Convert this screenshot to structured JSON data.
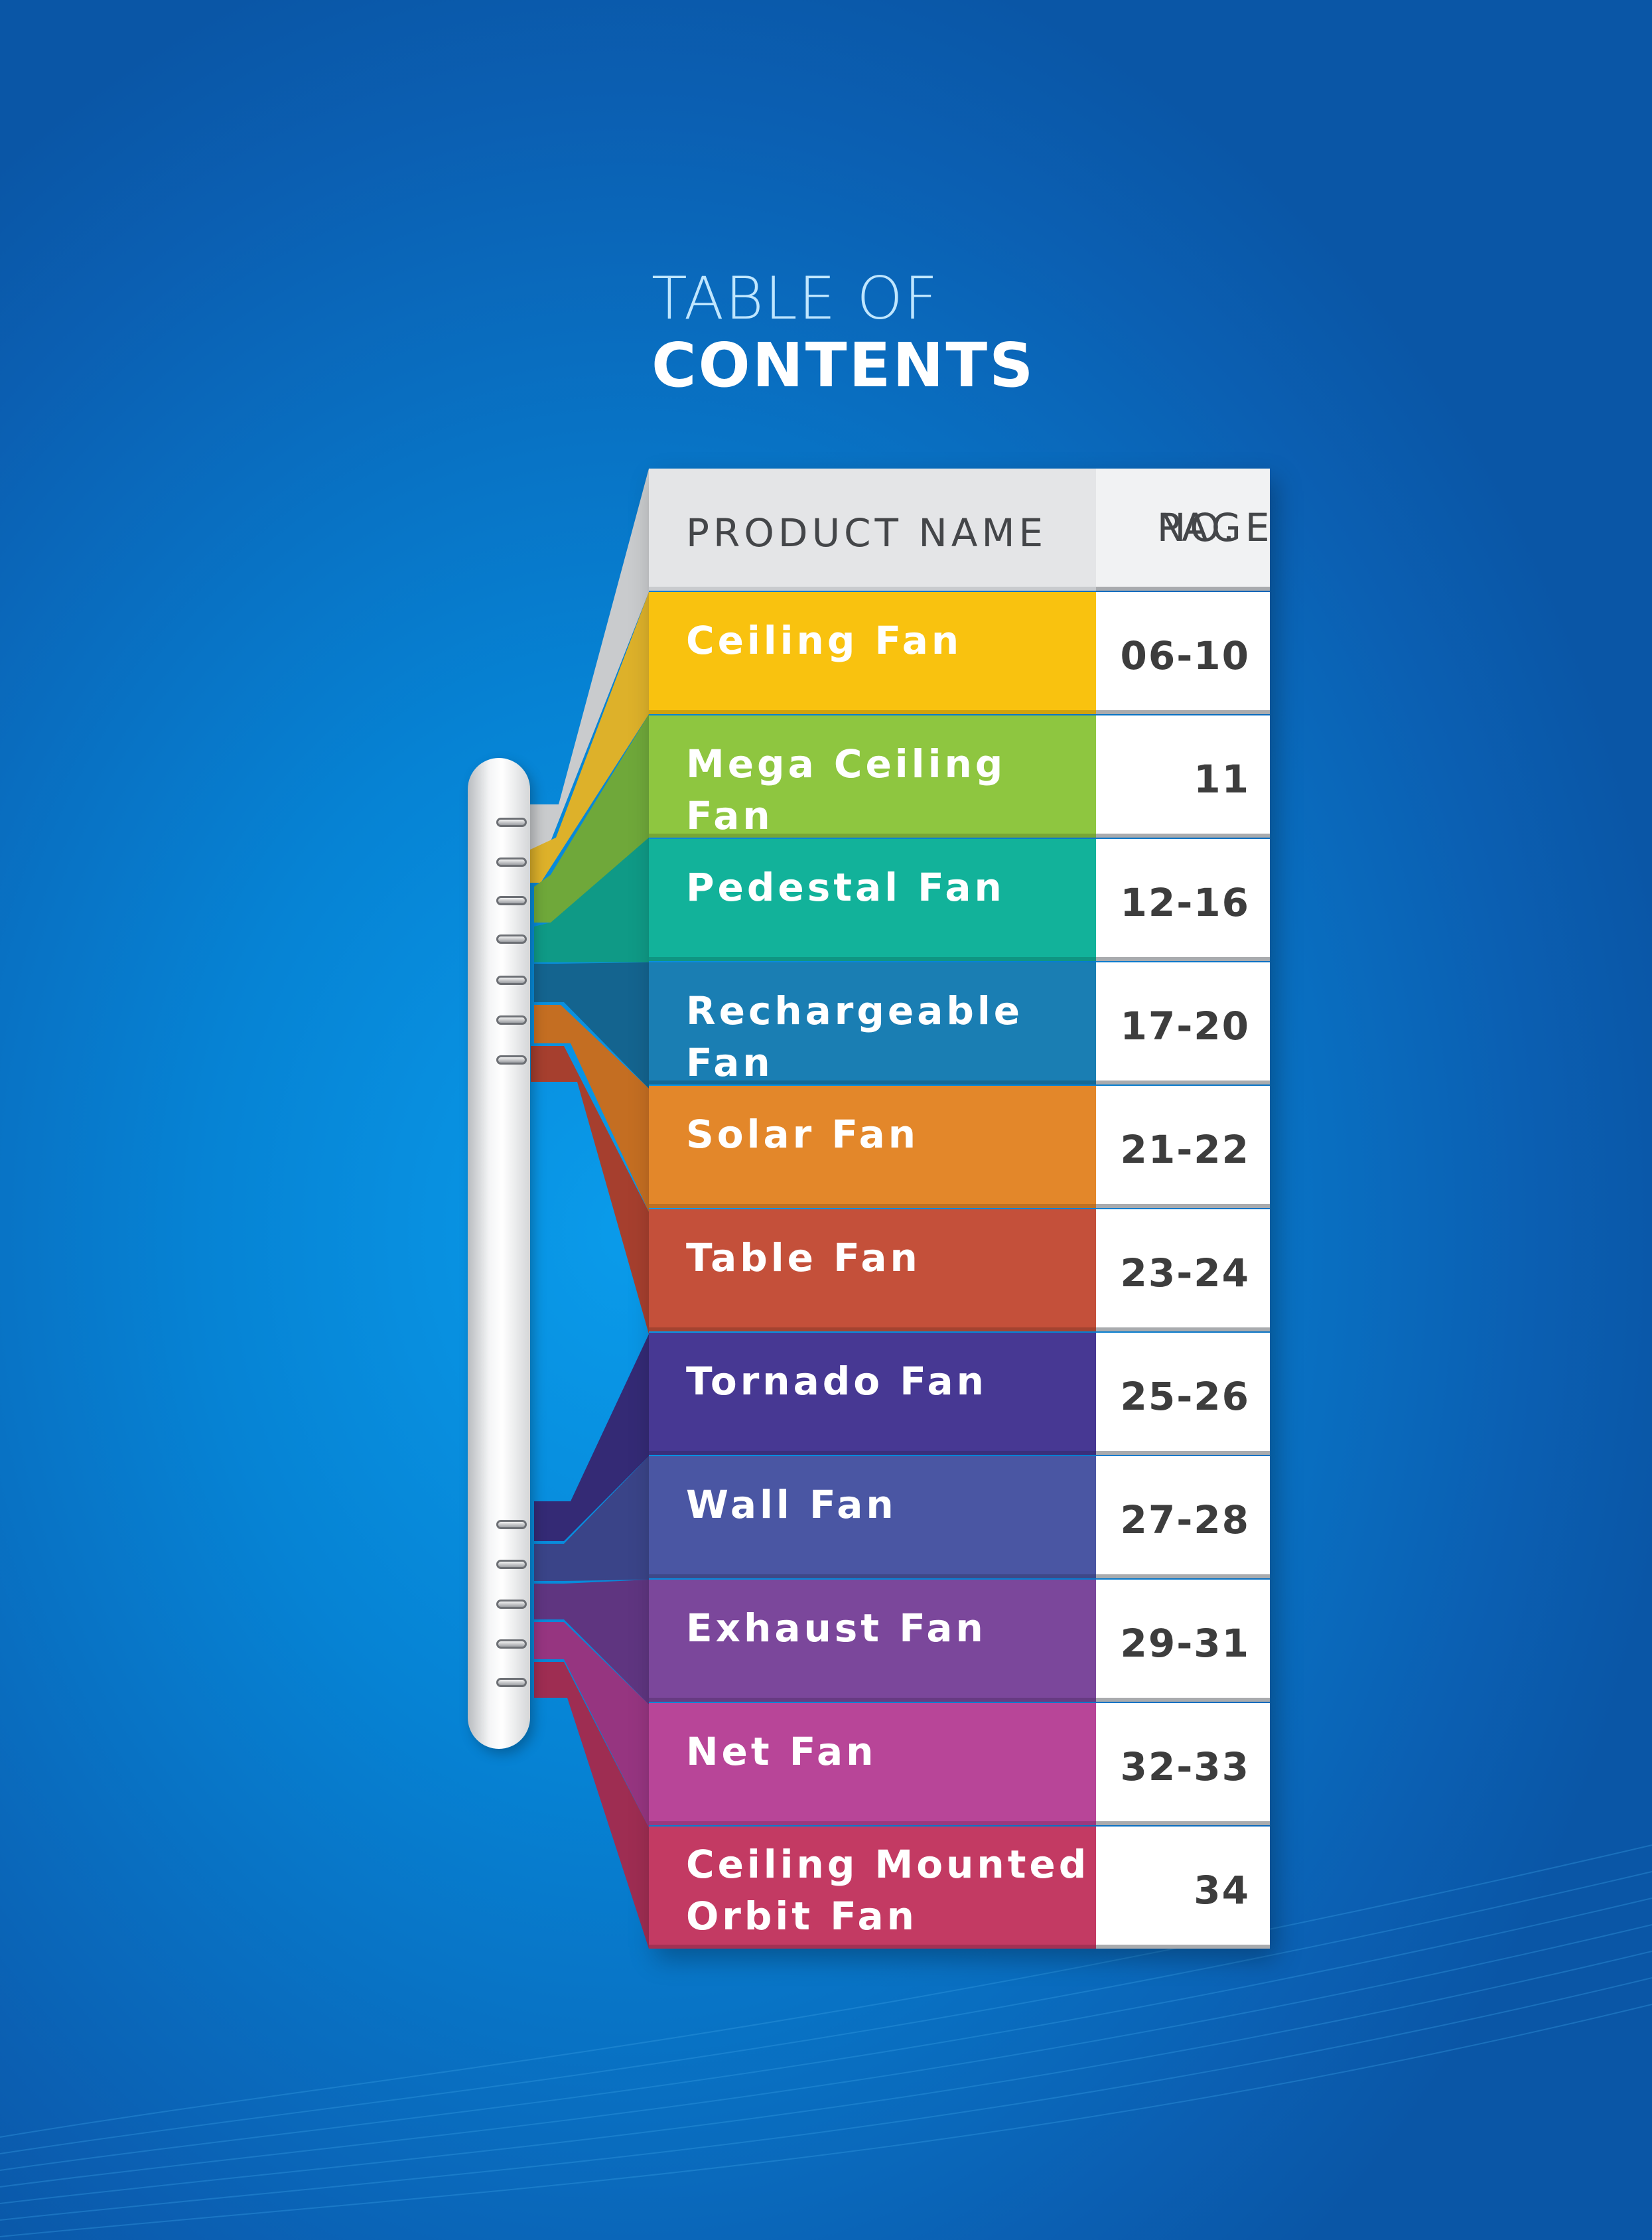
{
  "title": {
    "line1": "TABLE OF",
    "line2": "CONTENTS"
  },
  "table": {
    "header": {
      "name": "PRODUCT NAME",
      "page_line1": "PAGE",
      "page_line2": "NO."
    },
    "rows": [
      {
        "name": "Ceiling Fan",
        "page": "06-10",
        "color": "#f9c20f"
      },
      {
        "name": "Mega Ceiling Fan",
        "page": "11",
        "color": "#8ec640"
      },
      {
        "name": "Pedestal Fan",
        "page": "12-16",
        "color": "#12b29a"
      },
      {
        "name": "Rechargeable Fan",
        "page": "17-20",
        "color": "#1a7eb3"
      },
      {
        "name": "Solar Fan",
        "page": "21-22",
        "color": "#e3872a"
      },
      {
        "name": "Table Fan",
        "page": "23-24",
        "color": "#c4503a"
      },
      {
        "name": "Tornado Fan",
        "page": "25-26",
        "color": "#473893"
      },
      {
        "name": "Wall Fan",
        "page": "27-28",
        "color": "#4a56a3"
      },
      {
        "name": "Exhaust Fan",
        "page": "29-31",
        "color": "#7b479b"
      },
      {
        "name": "Net Fan",
        "page": "32-33",
        "color": "#b84598"
      },
      {
        "name": "Ceiling Mounted Orbit Fan",
        "name_line1": "Ceiling Mounted",
        "name_line2": "Orbit Fan",
        "page": "34",
        "color": "#c33a63"
      }
    ]
  },
  "colors": {
    "background": "#0683d4",
    "header": "#e4e5e7",
    "page_cell": "#ffffff"
  },
  "icons": {
    "binder": "spiral-binder-icon"
  }
}
